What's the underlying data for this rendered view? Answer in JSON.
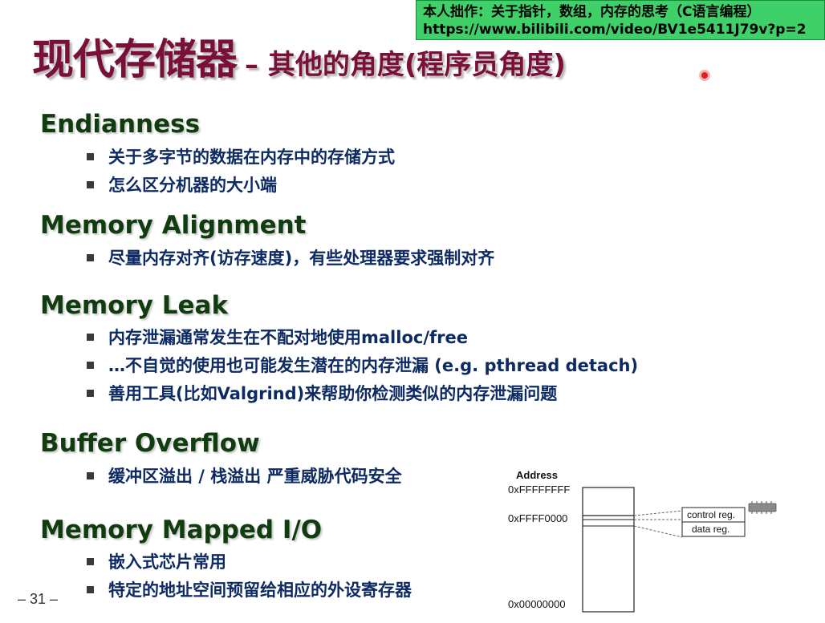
{
  "banner": {
    "line1": "本人拙作：关于指针，数组，内存的思考（C语言编程）",
    "line2": "https://www.bilibili.com/video/BV1e5411J79v?p=2"
  },
  "title": {
    "main": "现代存储器",
    "sub": "– 其他的角度(程序员角度)"
  },
  "sections": [
    {
      "heading": "Endianness",
      "bullets": [
        "关于多字节的数据在内存中的存储方式",
        "怎么区分机器的大小端"
      ]
    },
    {
      "heading": "Memory Alignment",
      "bullets": [
        "尽量内存对齐(访存速度)，有些处理器要求强制对齐"
      ]
    },
    {
      "heading": "Memory Leak",
      "bullets": [
        "内存泄漏通常发生在不配对地使用malloc/free",
        "…不自觉的使用也可能发生潜在的内存泄漏 (e.g. pthread detach)",
        "善用工具(比如Valgrind)来帮助你检测类似的内存泄漏问题"
      ]
    },
    {
      "heading": "Buffer Overflow",
      "bullets": [
        "缓冲区溢出 / 栈溢出 严重威胁代码安全"
      ]
    },
    {
      "heading": "Memory Mapped I/O",
      "bullets": [
        "嵌入式芯片常用",
        "特定的地址空间预留给相应的外设寄存器"
      ]
    }
  ],
  "page_number": "– 31 –",
  "diagram": {
    "header": "Address",
    "addresses": [
      "0xFFFFFFFF",
      "0xFFFF0000",
      "0x00000000"
    ],
    "registers": [
      "control reg.",
      "data reg."
    ]
  }
}
